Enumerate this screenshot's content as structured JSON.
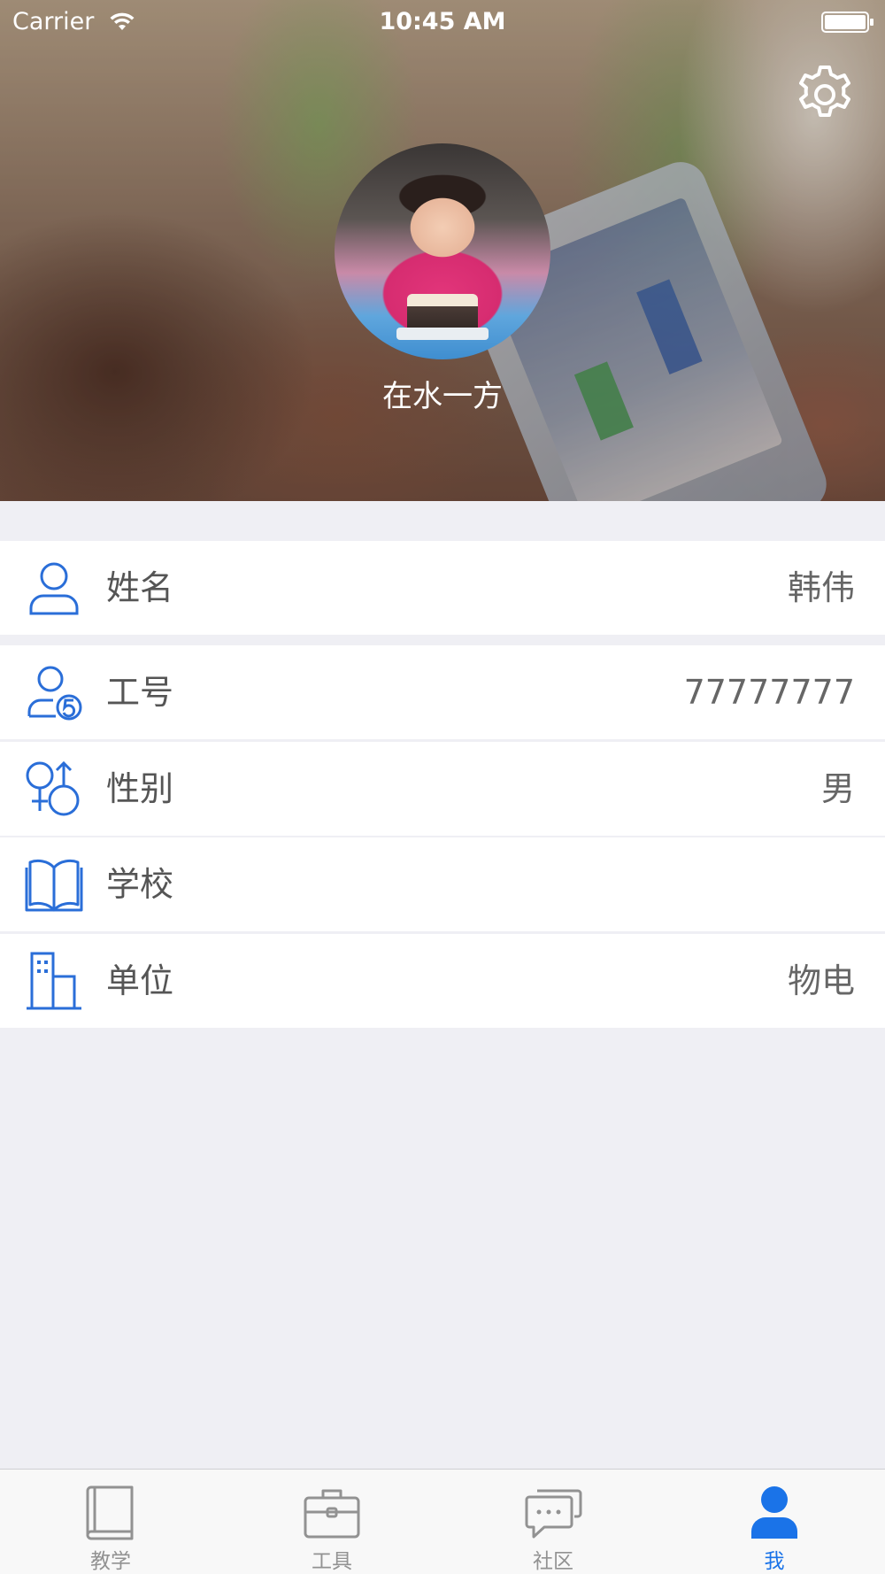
{
  "status_bar": {
    "carrier": "Carrier",
    "time": "10:45 AM"
  },
  "profile": {
    "nickname": "在水一方"
  },
  "info_rows": [
    {
      "label": "姓名",
      "value": "韩伟"
    },
    {
      "label": "工号",
      "value": "77777777"
    },
    {
      "label": "性别",
      "value": "男"
    },
    {
      "label": "学校",
      "value": ""
    },
    {
      "label": "单位",
      "value": "物电"
    }
  ],
  "tab_bar": {
    "tabs": [
      {
        "label": "教学",
        "icon": "book-icon"
      },
      {
        "label": "工具",
        "icon": "toolbox-icon"
      },
      {
        "label": "社区",
        "icon": "chat-bubbles-icon"
      },
      {
        "label": "我",
        "icon": "person-icon"
      }
    ],
    "active_index": 3
  },
  "colors": {
    "accent": "#1a73e8",
    "icon_blue": "#2a6ed8",
    "background": "#efeff4",
    "inactive": "#929292"
  }
}
